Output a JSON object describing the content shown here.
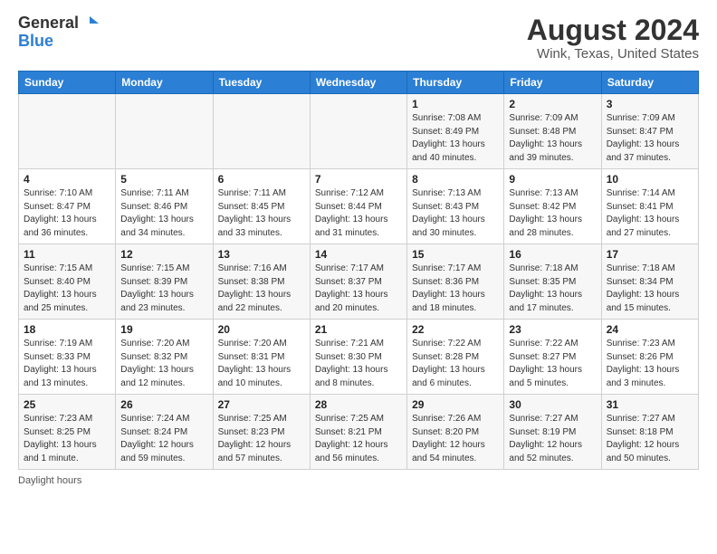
{
  "header": {
    "logo_line1": "General",
    "logo_line2": "Blue",
    "title": "August 2024",
    "subtitle": "Wink, Texas, United States"
  },
  "days_of_week": [
    "Sunday",
    "Monday",
    "Tuesday",
    "Wednesday",
    "Thursday",
    "Friday",
    "Saturday"
  ],
  "weeks": [
    [
      {
        "day": "",
        "info": ""
      },
      {
        "day": "",
        "info": ""
      },
      {
        "day": "",
        "info": ""
      },
      {
        "day": "",
        "info": ""
      },
      {
        "day": "1",
        "info": "Sunrise: 7:08 AM\nSunset: 8:49 PM\nDaylight: 13 hours\nand 40 minutes."
      },
      {
        "day": "2",
        "info": "Sunrise: 7:09 AM\nSunset: 8:48 PM\nDaylight: 13 hours\nand 39 minutes."
      },
      {
        "day": "3",
        "info": "Sunrise: 7:09 AM\nSunset: 8:47 PM\nDaylight: 13 hours\nand 37 minutes."
      }
    ],
    [
      {
        "day": "4",
        "info": "Sunrise: 7:10 AM\nSunset: 8:47 PM\nDaylight: 13 hours\nand 36 minutes."
      },
      {
        "day": "5",
        "info": "Sunrise: 7:11 AM\nSunset: 8:46 PM\nDaylight: 13 hours\nand 34 minutes."
      },
      {
        "day": "6",
        "info": "Sunrise: 7:11 AM\nSunset: 8:45 PM\nDaylight: 13 hours\nand 33 minutes."
      },
      {
        "day": "7",
        "info": "Sunrise: 7:12 AM\nSunset: 8:44 PM\nDaylight: 13 hours\nand 31 minutes."
      },
      {
        "day": "8",
        "info": "Sunrise: 7:13 AM\nSunset: 8:43 PM\nDaylight: 13 hours\nand 30 minutes."
      },
      {
        "day": "9",
        "info": "Sunrise: 7:13 AM\nSunset: 8:42 PM\nDaylight: 13 hours\nand 28 minutes."
      },
      {
        "day": "10",
        "info": "Sunrise: 7:14 AM\nSunset: 8:41 PM\nDaylight: 13 hours\nand 27 minutes."
      }
    ],
    [
      {
        "day": "11",
        "info": "Sunrise: 7:15 AM\nSunset: 8:40 PM\nDaylight: 13 hours\nand 25 minutes."
      },
      {
        "day": "12",
        "info": "Sunrise: 7:15 AM\nSunset: 8:39 PM\nDaylight: 13 hours\nand 23 minutes."
      },
      {
        "day": "13",
        "info": "Sunrise: 7:16 AM\nSunset: 8:38 PM\nDaylight: 13 hours\nand 22 minutes."
      },
      {
        "day": "14",
        "info": "Sunrise: 7:17 AM\nSunset: 8:37 PM\nDaylight: 13 hours\nand 20 minutes."
      },
      {
        "day": "15",
        "info": "Sunrise: 7:17 AM\nSunset: 8:36 PM\nDaylight: 13 hours\nand 18 minutes."
      },
      {
        "day": "16",
        "info": "Sunrise: 7:18 AM\nSunset: 8:35 PM\nDaylight: 13 hours\nand 17 minutes."
      },
      {
        "day": "17",
        "info": "Sunrise: 7:18 AM\nSunset: 8:34 PM\nDaylight: 13 hours\nand 15 minutes."
      }
    ],
    [
      {
        "day": "18",
        "info": "Sunrise: 7:19 AM\nSunset: 8:33 PM\nDaylight: 13 hours\nand 13 minutes."
      },
      {
        "day": "19",
        "info": "Sunrise: 7:20 AM\nSunset: 8:32 PM\nDaylight: 13 hours\nand 12 minutes."
      },
      {
        "day": "20",
        "info": "Sunrise: 7:20 AM\nSunset: 8:31 PM\nDaylight: 13 hours\nand 10 minutes."
      },
      {
        "day": "21",
        "info": "Sunrise: 7:21 AM\nSunset: 8:30 PM\nDaylight: 13 hours\nand 8 minutes."
      },
      {
        "day": "22",
        "info": "Sunrise: 7:22 AM\nSunset: 8:28 PM\nDaylight: 13 hours\nand 6 minutes."
      },
      {
        "day": "23",
        "info": "Sunrise: 7:22 AM\nSunset: 8:27 PM\nDaylight: 13 hours\nand 5 minutes."
      },
      {
        "day": "24",
        "info": "Sunrise: 7:23 AM\nSunset: 8:26 PM\nDaylight: 13 hours\nand 3 minutes."
      }
    ],
    [
      {
        "day": "25",
        "info": "Sunrise: 7:23 AM\nSunset: 8:25 PM\nDaylight: 13 hours\nand 1 minute."
      },
      {
        "day": "26",
        "info": "Sunrise: 7:24 AM\nSunset: 8:24 PM\nDaylight: 12 hours\nand 59 minutes."
      },
      {
        "day": "27",
        "info": "Sunrise: 7:25 AM\nSunset: 8:23 PM\nDaylight: 12 hours\nand 57 minutes."
      },
      {
        "day": "28",
        "info": "Sunrise: 7:25 AM\nSunset: 8:21 PM\nDaylight: 12 hours\nand 56 minutes."
      },
      {
        "day": "29",
        "info": "Sunrise: 7:26 AM\nSunset: 8:20 PM\nDaylight: 12 hours\nand 54 minutes."
      },
      {
        "day": "30",
        "info": "Sunrise: 7:27 AM\nSunset: 8:19 PM\nDaylight: 12 hours\nand 52 minutes."
      },
      {
        "day": "31",
        "info": "Sunrise: 7:27 AM\nSunset: 8:18 PM\nDaylight: 12 hours\nand 50 minutes."
      }
    ]
  ],
  "footer": {
    "daylight_label": "Daylight hours"
  }
}
